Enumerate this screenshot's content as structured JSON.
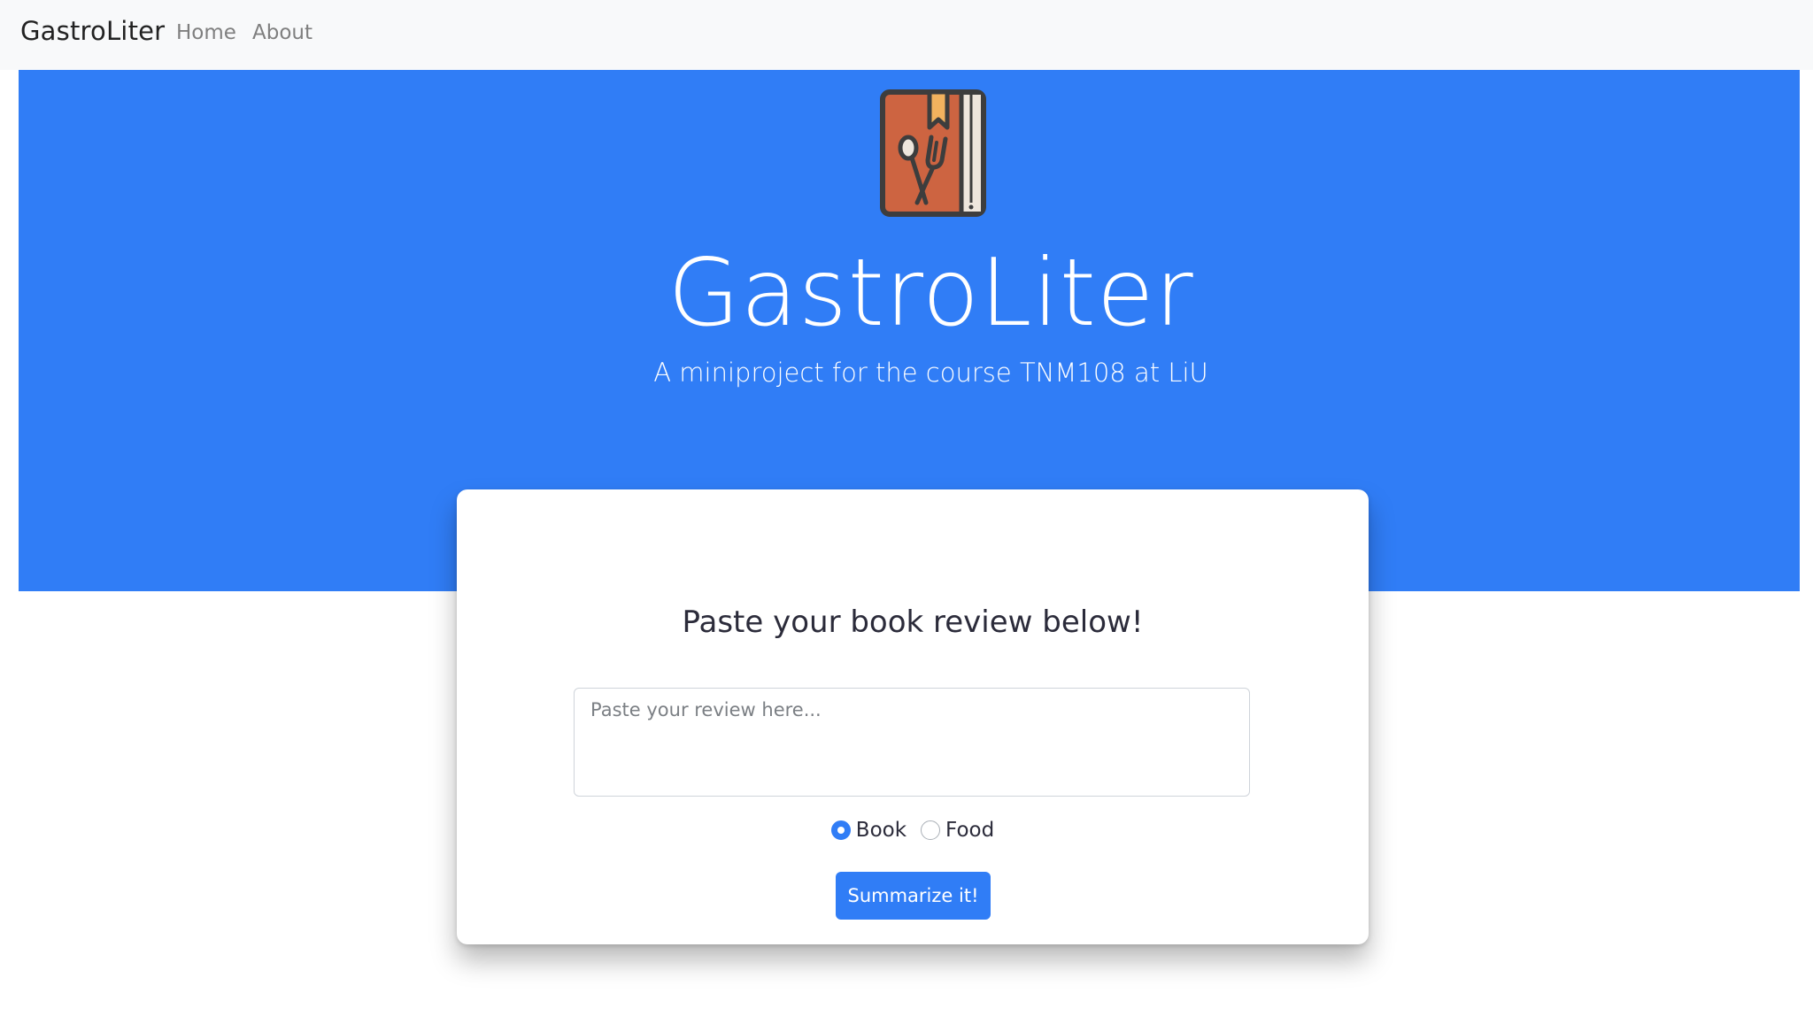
{
  "navbar": {
    "brand": "GastroLiter",
    "links": [
      {
        "label": "Home"
      },
      {
        "label": "About"
      }
    ]
  },
  "hero": {
    "title": "GastroLiter",
    "subtitle": "A miniproject for the course TNM108 at LiU",
    "logo_icon": "cookbook-icon",
    "background_color": "#307df6"
  },
  "form": {
    "heading": "Paste your book review below!",
    "review_placeholder": "Paste your review here...",
    "review_value": "",
    "options": [
      {
        "label": "Book",
        "checked": true
      },
      {
        "label": "Food",
        "checked": false
      }
    ],
    "submit_label": "Summarize it!"
  }
}
